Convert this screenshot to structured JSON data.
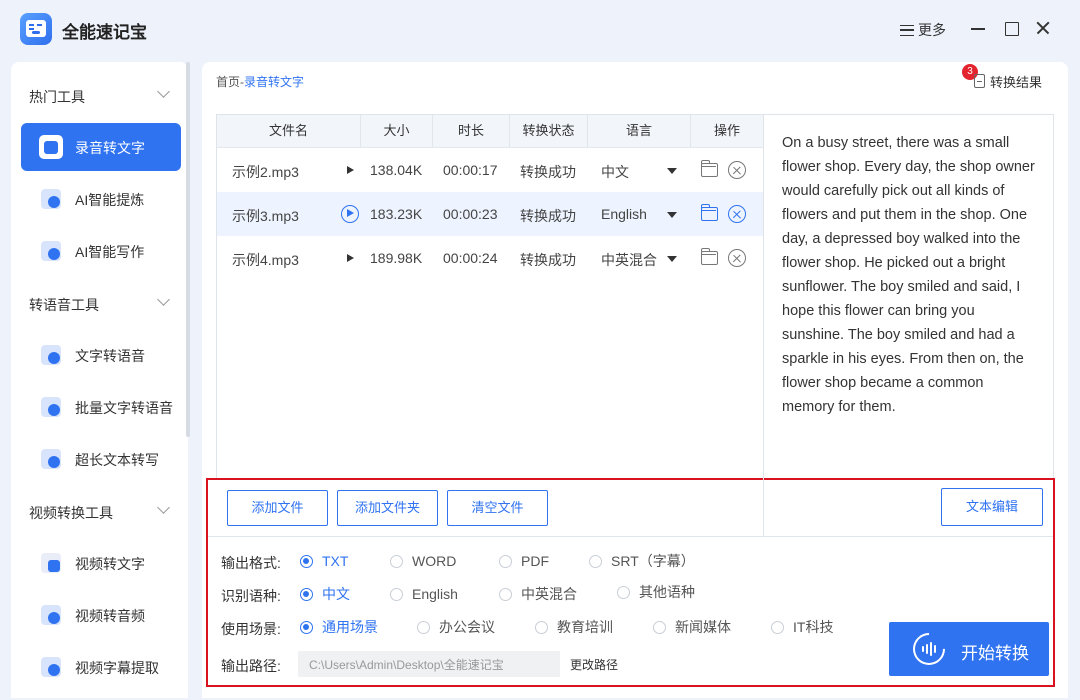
{
  "app": {
    "title": "全能速记宝",
    "more_label": "更多"
  },
  "sidebar": {
    "groups": [
      {
        "label": "热门工具",
        "items": [
          "录音转文字",
          "AI智能提炼",
          "AI智能写作"
        ]
      },
      {
        "label": "转语音工具",
        "items": [
          "文字转语音",
          "批量文字转语音",
          "超长文本转写"
        ]
      },
      {
        "label": "视频转换工具",
        "items": [
          "视频转文字",
          "视频转音频",
          "视频字幕提取"
        ]
      }
    ],
    "active_item": "录音转文字"
  },
  "breadcrumb": {
    "home": "首页",
    "separator": "-",
    "current": "录音转文字"
  },
  "results": {
    "label": "转换结果",
    "count": "3"
  },
  "table": {
    "headers": [
      "文件名",
      "大小",
      "时长",
      "转换状态",
      "语言",
      "操作"
    ],
    "rows": [
      {
        "name": "示例2.mp3",
        "size": "138.04K",
        "duration": "00:00:17",
        "status": "转换成功",
        "language": "中文"
      },
      {
        "name": "示例3.mp3",
        "size": "183.23K",
        "duration": "00:00:23",
        "status": "转换成功",
        "language": "English"
      },
      {
        "name": "示例4.mp3",
        "size": "189.98K",
        "duration": "00:00:24",
        "status": "转换成功",
        "language": "中英混合"
      }
    ],
    "selected_row": 1
  },
  "transcript": "On a busy street, there was a small flower shop. Every day, the shop owner would carefully pick out all kinds of flowers and put them in the shop. One day, a depressed boy walked into the flower shop. He picked out a bright sunflower. The boy smiled and said, I hope this flower can bring you sunshine. The boy smiled and had a sparkle in his eyes. From then on, the flower shop became a common memory for them.",
  "actions": {
    "add_file": "添加文件",
    "add_folder": "添加文件夹",
    "clear_files": "清空文件",
    "text_edit": "文本编辑"
  },
  "options": {
    "format": {
      "label": "输出格式:",
      "choices": [
        "TXT",
        "WORD",
        "PDF",
        "SRT（字幕）"
      ],
      "selected": "TXT"
    },
    "language": {
      "label": "识别语种:",
      "choices": [
        "中文",
        "English",
        "中英混合",
        "其他语种"
      ],
      "selected": "中文"
    },
    "scene": {
      "label": "使用场景:",
      "choices": [
        "通用场景",
        "办公会议",
        "教育培训",
        "新闻媒体",
        "IT科技"
      ],
      "selected": "通用场景"
    }
  },
  "output_path": {
    "label": "输出路径:",
    "value": "C:\\Users\\Admin\\Desktop\\全能速记宝",
    "change_label": "更改路径"
  },
  "start_button": {
    "label": "开始转换"
  },
  "colors": {
    "accent": "#2f73f1",
    "highlight_frame": "#d9121f",
    "badge": "#e3232d"
  }
}
